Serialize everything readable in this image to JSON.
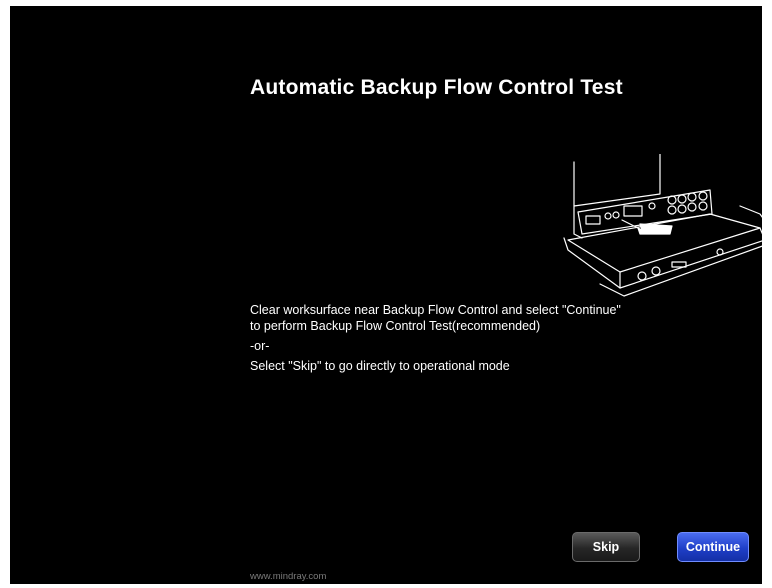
{
  "title": "Automatic Backup Flow Control Test",
  "instructions": {
    "line1": "Clear worksurface near Backup Flow Control and select \"Continue\"",
    "line2": "to perform Backup Flow Control Test(recommended)",
    "line3": "-or-",
    "line4": "Select \"Skip\" to go directly to operational mode"
  },
  "buttons": {
    "skip_label": "Skip",
    "continue_label": "Continue"
  },
  "footer": "www.mindray.com",
  "colors": {
    "background": "#000000",
    "continue_accent": "#1f3fc8"
  },
  "illustration": {
    "icon": "device-worksurface-illustration"
  }
}
